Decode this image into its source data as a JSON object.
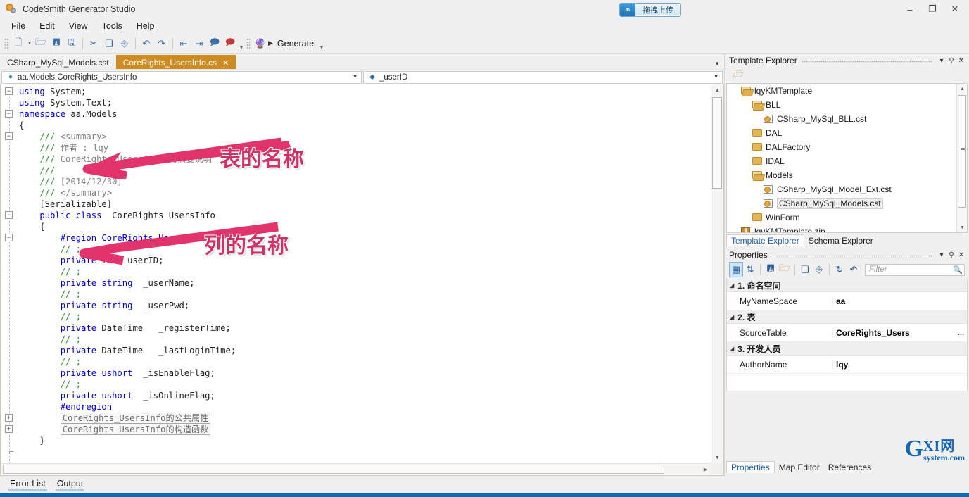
{
  "window": {
    "title": "CodeSmith Generator Studio",
    "app_icon": "gear-icon",
    "minimize": "–",
    "maximize": "❐",
    "close": "✕"
  },
  "upload_button": {
    "label": "拖拽上传",
    "icon": "cloud-upload-icon"
  },
  "menubar": {
    "items": [
      "File",
      "Edit",
      "View",
      "Tools",
      "Help"
    ]
  },
  "toolbar": {
    "buttons": [
      {
        "name": "new-file-button",
        "glyph": "🗋"
      },
      {
        "name": "open-file-button",
        "glyph": "📂"
      },
      {
        "name": "save-button",
        "glyph": "💾"
      },
      {
        "name": "save-all-button",
        "glyph": "🖫"
      },
      {
        "name": "cut-button",
        "glyph": "✂"
      },
      {
        "name": "copy-button",
        "glyph": "❏"
      },
      {
        "name": "paste-button",
        "glyph": "📋"
      },
      {
        "name": "undo-button",
        "glyph": "↺"
      },
      {
        "name": "redo-button",
        "glyph": "↻"
      },
      {
        "name": "outdent-button",
        "glyph": "⇤"
      },
      {
        "name": "indent-button",
        "glyph": "⇥"
      },
      {
        "name": "comment-button",
        "glyph": "🗩"
      },
      {
        "name": "uncomment-button",
        "glyph": "🗩"
      },
      {
        "name": "build-button",
        "glyph": "⚒"
      }
    ],
    "generate_label": "Generate",
    "play_glyph": "▶"
  },
  "editor": {
    "tabs": [
      {
        "label": "CSharp_MySql_Models.cst",
        "active": false,
        "closable": false
      },
      {
        "label": "CoreRights_UsersInfo.cs",
        "active": true,
        "closable": true,
        "close_glyph": "✕"
      }
    ],
    "nav": {
      "type_selector": "aa.Models.CoreRights_UsersInfo",
      "type_icon": "class-icon",
      "member_selector": "_userID",
      "member_icon": "field-icon",
      "caret": "▾"
    },
    "code_lines": [
      {
        "fold": "minus",
        "segments": [
          {
            "t": "using",
            "c": "kw"
          },
          {
            "t": " System;",
            "c": "ty"
          }
        ]
      },
      {
        "fold": "",
        "segments": [
          {
            "t": "using",
            "c": "kw"
          },
          {
            "t": " System.Text;",
            "c": "ty"
          }
        ]
      },
      {
        "fold": "minus",
        "segments": [
          {
            "t": "namespace",
            "c": "kw"
          },
          {
            "t": " aa.Models",
            "c": "ty"
          }
        ]
      },
      {
        "fold": "",
        "segments": [
          {
            "t": "{",
            "c": "ty"
          }
        ]
      },
      {
        "fold": "minus",
        "segments": [
          {
            "t": "    /// ",
            "c": "cm"
          },
          {
            "t": "<summary>",
            "c": "doc"
          }
        ]
      },
      {
        "fold": "",
        "segments": [
          {
            "t": "    /// ",
            "c": "cm"
          },
          {
            "t": "作者 : lqy",
            "c": "doc"
          }
        ]
      },
      {
        "fold": "",
        "segments": [
          {
            "t": "    /// ",
            "c": "cm"
          },
          {
            "t": "CoreRights_UsersInfo 的摘要说明",
            "c": "doc"
          }
        ]
      },
      {
        "fold": "",
        "segments": [
          {
            "t": "    /// ",
            "c": "cm"
          }
        ]
      },
      {
        "fold": "",
        "segments": [
          {
            "t": "    /// ",
            "c": "cm"
          },
          {
            "t": "[2014/12/30]",
            "c": "doc"
          }
        ]
      },
      {
        "fold": "",
        "segments": [
          {
            "t": "    /// ",
            "c": "cm"
          },
          {
            "t": "</summary>",
            "c": "doc"
          }
        ]
      },
      {
        "fold": "",
        "segments": [
          {
            "t": "    [Serializable]",
            "c": "ty"
          }
        ]
      },
      {
        "fold": "minus",
        "segments": [
          {
            "t": "    ",
            "c": "ty"
          },
          {
            "t": "public class",
            "c": "kw"
          },
          {
            "t": "  CoreRights_UsersInfo",
            "c": "ty"
          }
        ]
      },
      {
        "fold": "",
        "segments": [
          {
            "t": "    {",
            "c": "ty"
          }
        ]
      },
      {
        "fold": "minus",
        "segments": [
          {
            "t": "        #region CoreRights_UsersInfo",
            "c": "pp"
          }
        ]
      },
      {
        "fold": "",
        "segments": [
          {
            "t": "        // ;",
            "c": "cm"
          }
        ]
      },
      {
        "fold": "",
        "segments": [
          {
            "t": "        ",
            "c": "ty"
          },
          {
            "t": "private int",
            "c": "kw"
          },
          {
            "t": " _userID;",
            "c": "ty"
          }
        ]
      },
      {
        "fold": "",
        "segments": [
          {
            "t": "        // ;",
            "c": "cm"
          }
        ]
      },
      {
        "fold": "",
        "segments": [
          {
            "t": "        ",
            "c": "ty"
          },
          {
            "t": "private string",
            "c": "kw"
          },
          {
            "t": "  _userName;",
            "c": "ty"
          }
        ]
      },
      {
        "fold": "",
        "segments": [
          {
            "t": "        // ;",
            "c": "cm"
          }
        ]
      },
      {
        "fold": "",
        "segments": [
          {
            "t": "        ",
            "c": "ty"
          },
          {
            "t": "private string",
            "c": "kw"
          },
          {
            "t": "  _userPwd;",
            "c": "ty"
          }
        ]
      },
      {
        "fold": "",
        "segments": [
          {
            "t": "        // ;",
            "c": "cm"
          }
        ]
      },
      {
        "fold": "",
        "segments": [
          {
            "t": "        ",
            "c": "ty"
          },
          {
            "t": "private",
            "c": "kw"
          },
          {
            "t": " DateTime   _registerTime;",
            "c": "ty"
          }
        ]
      },
      {
        "fold": "",
        "segments": [
          {
            "t": "        // ;",
            "c": "cm"
          }
        ]
      },
      {
        "fold": "",
        "segments": [
          {
            "t": "        ",
            "c": "ty"
          },
          {
            "t": "private",
            "c": "kw"
          },
          {
            "t": " DateTime   _lastLoginTime;",
            "c": "ty"
          }
        ]
      },
      {
        "fold": "",
        "segments": [
          {
            "t": "        // ;",
            "c": "cm"
          }
        ]
      },
      {
        "fold": "",
        "segments": [
          {
            "t": "        ",
            "c": "ty"
          },
          {
            "t": "private ushort",
            "c": "kw"
          },
          {
            "t": "  _isEnableFlag;",
            "c": "ty"
          }
        ]
      },
      {
        "fold": "",
        "segments": [
          {
            "t": "        // ;",
            "c": "cm"
          }
        ]
      },
      {
        "fold": "",
        "segments": [
          {
            "t": "        ",
            "c": "ty"
          },
          {
            "t": "private ushort",
            "c": "kw"
          },
          {
            "t": "  _isOnlineFlag;",
            "c": "ty"
          }
        ]
      },
      {
        "fold": "",
        "segments": [
          {
            "t": "        #endregion",
            "c": "pp"
          }
        ]
      },
      {
        "fold": "plus",
        "collapsed": "CoreRights_UsersInfo的公共属性",
        "indent": 8
      },
      {
        "fold": "plus",
        "collapsed": "CoreRights_UsersInfo的构造函数",
        "indent": 8
      },
      {
        "fold": "",
        "segments": [
          {
            "t": "    }",
            "c": "ty"
          }
        ]
      }
    ]
  },
  "annotations": [
    {
      "name": "table-name-annotation",
      "text": "表的名称"
    },
    {
      "name": "column-name-annotation",
      "text": "列的名称"
    }
  ],
  "template_explorer": {
    "title": "Template Explorer",
    "dropdown_glyph": "▾",
    "pin_glyph": "⚲",
    "close_glyph": "✕",
    "toolbar": [
      {
        "name": "open-template-button",
        "glyph": "📂"
      }
    ],
    "tree": [
      {
        "label": "lqyKMTemplate",
        "icon": "folder-open-icon",
        "indent": 1,
        "selected": false
      },
      {
        "label": "BLL",
        "icon": "folder-open-icon",
        "indent": 2,
        "selected": false
      },
      {
        "label": "CSharp_MySql_BLL.cst",
        "icon": "template-file-icon",
        "indent": 3,
        "selected": false
      },
      {
        "label": "DAL",
        "icon": "folder-icon",
        "indent": 2,
        "selected": false
      },
      {
        "label": "DALFactory",
        "icon": "folder-icon",
        "indent": 2,
        "selected": false
      },
      {
        "label": "IDAL",
        "icon": "folder-icon",
        "indent": 2,
        "selected": false
      },
      {
        "label": "Models",
        "icon": "folder-open-icon",
        "indent": 2,
        "selected": false
      },
      {
        "label": "CSharp_MySql_Model_Ext.cst",
        "icon": "template-file-icon",
        "indent": 3,
        "selected": false
      },
      {
        "label": "CSharp_MySql_Models.cst",
        "icon": "template-file-icon",
        "indent": 3,
        "selected": true
      },
      {
        "label": "WinForm",
        "icon": "folder-icon",
        "indent": 2,
        "selected": false
      },
      {
        "label": "lqyKMTemplate.zip",
        "icon": "zip-icon",
        "indent": 1,
        "selected": false
      }
    ],
    "dock_tabs": [
      {
        "label": "Template Explorer",
        "active": true
      },
      {
        "label": "Schema Explorer",
        "active": false
      }
    ]
  },
  "properties": {
    "title": "Properties",
    "dropdown_glyph": "▾",
    "pin_glyph": "⚲",
    "close_glyph": "✕",
    "toolbar": [
      {
        "name": "categorized-view-button",
        "glyph": "▤"
      },
      {
        "name": "alphabetical-sort-button",
        "glyph": "⇅"
      },
      {
        "name": "save-properties-button",
        "glyph": "💾"
      },
      {
        "name": "load-properties-button",
        "glyph": "📂"
      },
      {
        "name": "copy-properties-button",
        "glyph": "❏"
      },
      {
        "name": "paste-properties-button",
        "glyph": "📋"
      },
      {
        "name": "refresh-button",
        "glyph": "↻"
      },
      {
        "name": "reset-button",
        "glyph": "↺"
      }
    ],
    "filter_placeholder": "Filter",
    "search_glyph": "🔍",
    "groups": [
      {
        "name": "1. 命名空间",
        "rows": [
          {
            "name": "MyNameSpace",
            "value": "aa",
            "ellipsis": ""
          }
        ]
      },
      {
        "name": "2. 表",
        "rows": [
          {
            "name": "SourceTable",
            "value": "CoreRights_Users",
            "ellipsis": "..."
          }
        ]
      },
      {
        "name": "3. 开发人员",
        "rows": [
          {
            "name": "AuthorName",
            "value": "lqy",
            "ellipsis": ""
          }
        ]
      }
    ],
    "dock_tabs": [
      {
        "label": "Properties",
        "active": true
      },
      {
        "label": "Map Editor",
        "active": false
      },
      {
        "label": "References",
        "active": false
      }
    ]
  },
  "bottom_tabs": [
    {
      "label": "Error List"
    },
    {
      "label": "Output"
    }
  ],
  "watermark": {
    "g": "G",
    "top": "XI网",
    "bottom": "system.com"
  },
  "colors": {
    "accent_tab": "#ce8b21",
    "status_bar": "#0d6ab4",
    "annotation": "#cf3268",
    "chrome": "#f0f0f0"
  }
}
